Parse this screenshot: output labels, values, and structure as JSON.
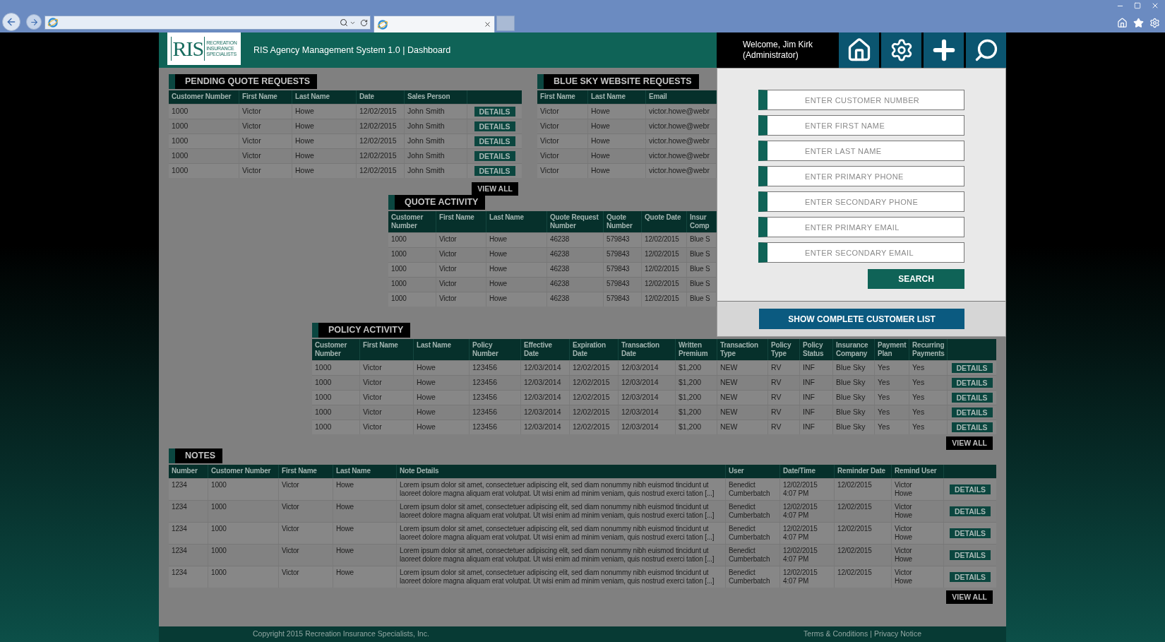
{
  "header": {
    "logo": {
      "letters": "RIS",
      "tagline": [
        "RECREATION",
        "INSURANCE",
        "SPECIALISTS"
      ]
    },
    "title": "RIS Agency Management System 1.0 | Dashboard",
    "welcome": [
      "Welcome, Jim Kirk",
      "(Administrator)"
    ]
  },
  "pending_quote_requests": {
    "title": "PENDING QUOTE REQUESTS",
    "columns": [
      "Customer Number",
      "First Name",
      "Last Name",
      "Date",
      "Sales Person"
    ],
    "rows": [
      {
        "cells": [
          "1000",
          "Victor",
          "Howe",
          "12/02/2015",
          "John Smith"
        ],
        "action": "DETAILS"
      },
      {
        "cells": [
          "1000",
          "Victor",
          "Howe",
          "12/02/2015",
          "John Smith"
        ],
        "action": "DETAILS"
      },
      {
        "cells": [
          "1000",
          "Victor",
          "Howe",
          "12/02/2015",
          "John Smith"
        ],
        "action": "DETAILS"
      },
      {
        "cells": [
          "1000",
          "Victor",
          "Howe",
          "12/02/2015",
          "John Smith"
        ],
        "action": "DETAILS"
      },
      {
        "cells": [
          "1000",
          "Victor",
          "Howe",
          "12/02/2015",
          "John Smith"
        ],
        "action": "DETAILS"
      }
    ],
    "view_all": "VIEW ALL"
  },
  "blue_sky_website_requests": {
    "title": "BLUE SKY WEBSITE REQUESTS",
    "columns": [
      "First Name",
      "Last Name",
      "Email"
    ],
    "rows": [
      {
        "cells": [
          "Victor",
          "Howe",
          "victor.howe@webr"
        ]
      },
      {
        "cells": [
          "Victor",
          "Howe",
          "victor.howe@webr"
        ]
      },
      {
        "cells": [
          "Victor",
          "Howe",
          "victor.howe@webr"
        ]
      },
      {
        "cells": [
          "Victor",
          "Howe",
          "victor.howe@webr"
        ]
      },
      {
        "cells": [
          "Victor",
          "Howe",
          "victor.howe@webr"
        ]
      }
    ]
  },
  "quote_activity": {
    "title": "QUOTE ACTIVITY",
    "columns": [
      "Customer Number",
      "First Name",
      "Last Name",
      "Quote Request Number",
      "Quote Number",
      "Quote Date",
      "Insur Comp"
    ],
    "rows": [
      {
        "cells": [
          "1000",
          "Victor",
          "Howe",
          "46238",
          "579843",
          "12/02/2015",
          "Blue S"
        ]
      },
      {
        "cells": [
          "1000",
          "Victor",
          "Howe",
          "46238",
          "579843",
          "12/02/2015",
          "Blue S"
        ]
      },
      {
        "cells": [
          "1000",
          "Victor",
          "Howe",
          "46238",
          "579843",
          "12/02/2015",
          "Blue S"
        ]
      },
      {
        "cells": [
          "1000",
          "Victor",
          "Howe",
          "46238",
          "579843",
          "12/02/2015",
          "Blue S"
        ]
      },
      {
        "cells": [
          "1000",
          "Victor",
          "Howe",
          "46238",
          "579843",
          "12/02/2015",
          "Blue S"
        ]
      }
    ]
  },
  "policy_activity": {
    "title": "POLICY ACTIVITY",
    "columns": [
      "Customer Number",
      "First Name",
      "Last Name",
      "Policy Number",
      "Effective Date",
      "Expiration Date",
      "Transaction Date",
      "Written Premium",
      "Transaction Type",
      "Policy Type",
      "Policy Status",
      "Insurance Company",
      "Payment Plan",
      "Recurring Payments"
    ],
    "rows": [
      {
        "cells": [
          "1000",
          "Victor",
          "Howe",
          "123456",
          "12/03/2014",
          "12/02/2015",
          "12/03/2014",
          "$1,200",
          "NEW",
          "RV",
          "INF",
          "Blue Sky",
          "Yes",
          "Yes"
        ],
        "action": "DETAILS"
      },
      {
        "cells": [
          "1000",
          "Victor",
          "Howe",
          "123456",
          "12/03/2014",
          "12/02/2015",
          "12/03/2014",
          "$1,200",
          "NEW",
          "RV",
          "INF",
          "Blue Sky",
          "Yes",
          "Yes"
        ],
        "action": "DETAILS"
      },
      {
        "cells": [
          "1000",
          "Victor",
          "Howe",
          "123456",
          "12/03/2014",
          "12/02/2015",
          "12/03/2014",
          "$1,200",
          "NEW",
          "RV",
          "INF",
          "Blue Sky",
          "Yes",
          "Yes"
        ],
        "action": "DETAILS"
      },
      {
        "cells": [
          "1000",
          "Victor",
          "Howe",
          "123456",
          "12/03/2014",
          "12/02/2015",
          "12/03/2014",
          "$1,200",
          "NEW",
          "RV",
          "INF",
          "Blue Sky",
          "Yes",
          "Yes"
        ],
        "action": "DETAILS"
      },
      {
        "cells": [
          "1000",
          "Victor",
          "Howe",
          "123456",
          "12/03/2014",
          "12/02/2015",
          "12/03/2014",
          "$1,200",
          "NEW",
          "RV",
          "INF",
          "Blue Sky",
          "Yes",
          "Yes"
        ],
        "action": "DETAILS"
      }
    ],
    "view_all": "VIEW ALL"
  },
  "notes": {
    "title": "NOTES",
    "columns": [
      "Number",
      "Customer Number",
      "First Name",
      "Last Name",
      "Note Details",
      "User",
      "Date/Time",
      "Reminder Date",
      "Remind User"
    ],
    "rows": [
      {
        "cells": [
          "1234",
          "1000",
          "Victor",
          "Howe",
          "Lorem ipsum dolor sit amet, consectetuer adipiscing elit, sed diam nonummy nibh euismod tincidunt ut laoreet dolore magna aliquam erat volutpat. Ut wisi enim ad minim veniam, quis nostrud exerci tation [...]",
          "Benedict\nCumberbatch",
          "12/02/2015\n4:07 PM",
          "12/02/2015",
          "Victor\nHowe"
        ],
        "action": "DETAILS"
      },
      {
        "cells": [
          "1234",
          "1000",
          "Victor",
          "Howe",
          "Lorem ipsum dolor sit amet, consectetuer adipiscing elit, sed diam nonummy nibh euismod tincidunt ut laoreet dolore magna aliquam erat volutpat. Ut wisi enim ad minim veniam, quis nostrud exerci tation [...]",
          "Benedict\nCumberbatch",
          "12/02/2015\n4:07 PM",
          "12/02/2015",
          "Victor\nHowe"
        ],
        "action": "DETAILS"
      },
      {
        "cells": [
          "1234",
          "1000",
          "Victor",
          "Howe",
          "Lorem ipsum dolor sit amet, consectetuer adipiscing elit, sed diam nonummy nibh euismod tincidunt ut laoreet dolore magna aliquam erat volutpat. Ut wisi enim ad minim veniam, quis nostrud exerci tation [...]",
          "Benedict\nCumberbatch",
          "12/02/2015\n4:07 PM",
          "12/02/2015",
          "Victor\nHowe"
        ],
        "action": "DETAILS"
      },
      {
        "cells": [
          "1234",
          "1000",
          "Victor",
          "Howe",
          "Lorem ipsum dolor sit amet, consectetuer adipiscing elit, sed diam nonummy nibh euismod tincidunt ut laoreet dolore magna aliquam erat volutpat. Ut wisi enim ad minim veniam, quis nostrud exerci tation [...]",
          "Benedict\nCumberbatch",
          "12/02/2015\n4:07 PM",
          "12/02/2015",
          "Victor\nHowe"
        ],
        "action": "DETAILS"
      },
      {
        "cells": [
          "1234",
          "1000",
          "Victor",
          "Howe",
          "Lorem ipsum dolor sit amet, consectetuer adipiscing elit, sed diam nonummy nibh euismod tincidunt ut laoreet dolore magna aliquam erat volutpat. Ut wisi enim ad minim veniam, quis nostrud exerci tation [...]",
          "Benedict\nCumberbatch",
          "12/02/2015\n4:07 PM",
          "12/02/2015",
          "Victor\nHowe"
        ],
        "action": "DETAILS"
      }
    ],
    "view_all": "VIEW ALL"
  },
  "search_panel": {
    "fields": [
      {
        "placeholder": "ENTER CUSTOMER NUMBER"
      },
      {
        "placeholder": "ENTER FIRST NAME"
      },
      {
        "placeholder": "ENTER LAST NAME"
      },
      {
        "placeholder": "ENTER PRIMARY PHONE"
      },
      {
        "placeholder": "ENTER SECONDARY PHONE"
      },
      {
        "placeholder": "ENTER PRIMARY EMAIL"
      },
      {
        "placeholder": "ENTER SECONDARY EMAIL"
      }
    ],
    "search_button": "SEARCH",
    "list_button": "SHOW COMPLETE CUSTOMER LIST"
  },
  "footer": {
    "copyright": "Copyright 2015 Recreation Insurance Specialists, Inc.",
    "links": [
      "Terms & Conditions",
      "Privacy Notice"
    ],
    "separator": "|"
  }
}
